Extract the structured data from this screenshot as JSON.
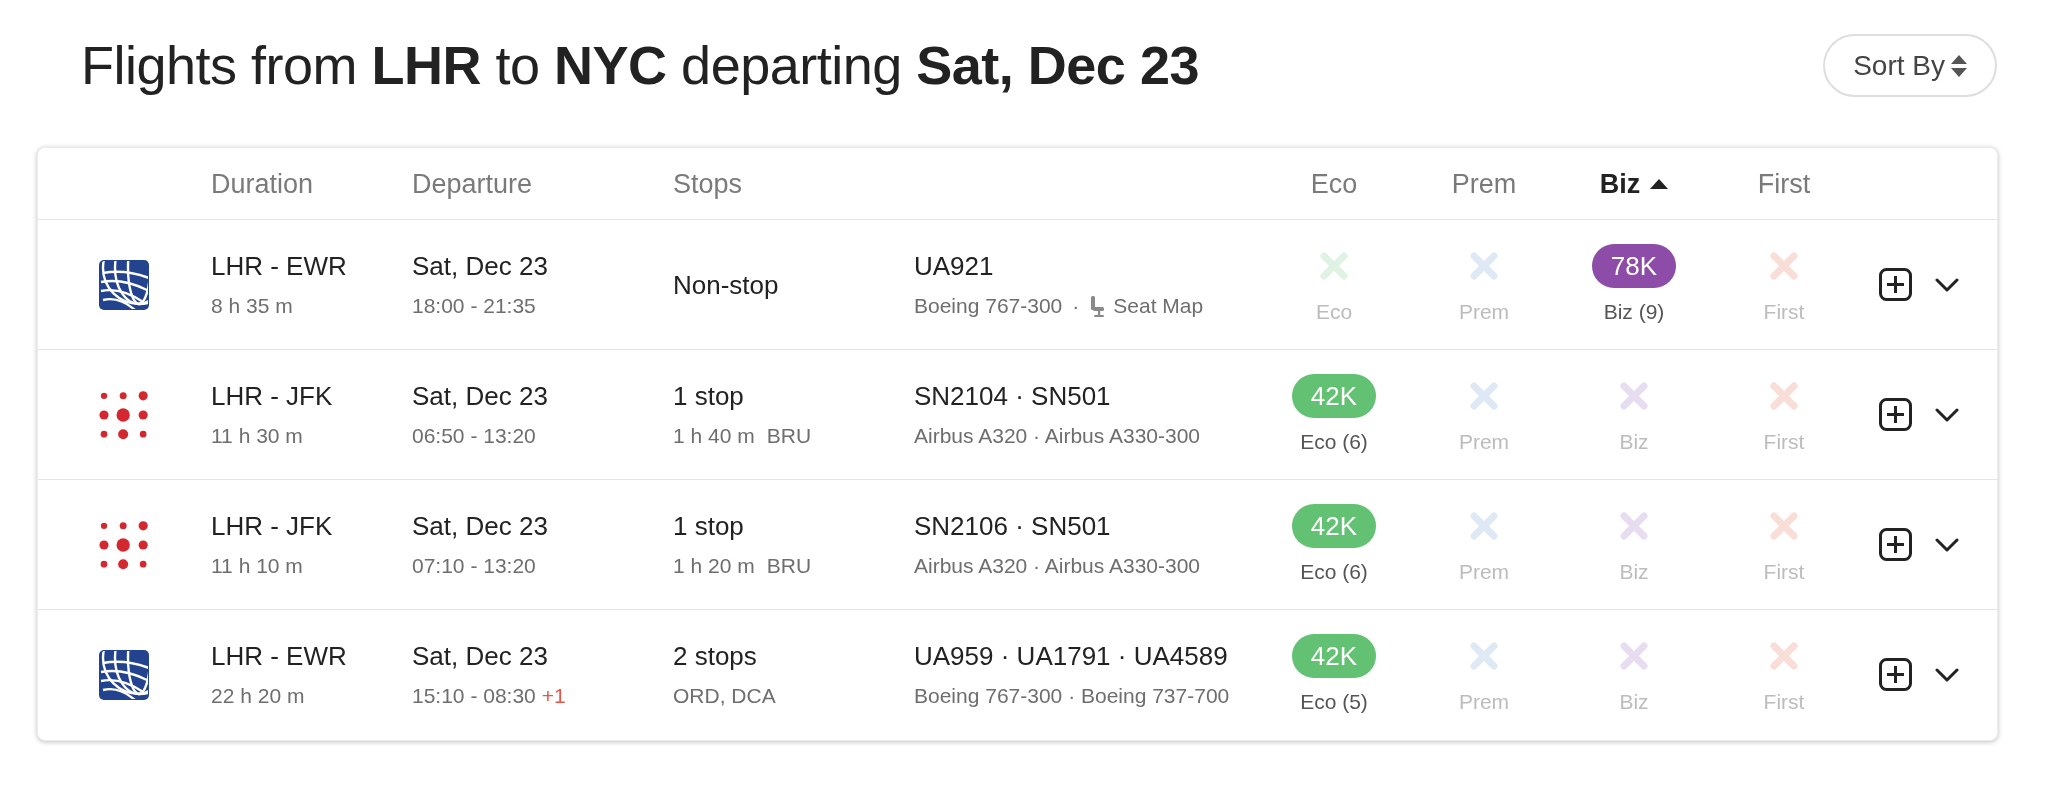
{
  "title": "Flights from **LHR** to **NYC** departing **Sat, Dec 23**",
  "sort_button": {
    "label": "Sort By"
  },
  "table": {
    "columns": [
      {
        "label": "Duration",
        "sorted": false
      },
      {
        "label": "Departure",
        "sorted": false
      },
      {
        "label": "Stops",
        "sorted": false
      }
    ],
    "cabins": [
      {
        "label": "Eco",
        "sorted": false,
        "color": "#dff2e3"
      },
      {
        "label": "Prem",
        "sorted": false,
        "color": "#dfe9f5"
      },
      {
        "label": "Biz",
        "sorted": true,
        "color": "#e8ddf0"
      },
      {
        "label": "First",
        "sorted": false,
        "color": "#f9ddd7"
      }
    ],
    "rows": [
      {
        "logo": {
          "kind": "globe"
        },
        "route": "LHR - EWR",
        "duration": "8 h 35 m",
        "date": "Sat, Dec 23",
        "times": "18:00 - 21:35",
        "stops": "Non-stop",
        "flights": "UA921",
        "aircraft": "Boeing 767-300",
        "seat_map": {
          "separator": "·",
          "label": "Seat Map"
        },
        "fares": [
          {
            "available": false,
            "label": "Eco"
          },
          {
            "available": false,
            "label": "Prem"
          },
          {
            "available": true,
            "price": "78K",
            "label": "Biz (9)",
            "color": "#8c4ca8"
          },
          {
            "available": false,
            "label": "First"
          }
        ],
        "expanded": false
      },
      {
        "logo": {
          "kind": "dots"
        },
        "route": "LHR - JFK",
        "duration": "11 h 30 m",
        "date": "Sat, Dec 23",
        "times": "06:50 - 13:20",
        "stops": "1 stop",
        "layover": {
          "duration": "1 h 40 m",
          "airports": "BRU"
        },
        "flights": "SN2104 · SN501",
        "aircraft": "Airbus A320 · Airbus A330-300",
        "fares": [
          {
            "available": true,
            "price": "42K",
            "label": "Eco (6)",
            "color": "#62c172"
          },
          {
            "available": false,
            "label": "Prem"
          },
          {
            "available": false,
            "label": "Biz"
          },
          {
            "available": false,
            "label": "First"
          }
        ],
        "expanded": false
      },
      {
        "logo": {
          "kind": "dots"
        },
        "route": "LHR - JFK",
        "duration": "11 h 10 m",
        "date": "Sat, Dec 23",
        "times": "07:10 - 13:20",
        "stops": "1 stop",
        "layover": {
          "duration": "1 h 20 m",
          "airports": "BRU"
        },
        "flights": "SN2106 · SN501",
        "aircraft": "Airbus A320 · Airbus A330-300",
        "fares": [
          {
            "available": true,
            "price": "42K",
            "label": "Eco (6)",
            "color": "#62c172"
          },
          {
            "available": false,
            "label": "Prem"
          },
          {
            "available": false,
            "label": "Biz"
          },
          {
            "available": false,
            "label": "First"
          }
        ],
        "expanded": false
      },
      {
        "logo": {
          "kind": "globe"
        },
        "route": "LHR - EWR",
        "duration": "22 h 20 m",
        "date": "Sat, Dec 23",
        "times": "15:10 - 08:30",
        "day_offset": "+1",
        "stops": "2 stops",
        "layover": {
          "airports": "ORD, DCA"
        },
        "flights": "UA959 · UA1791 · UA4589",
        "aircraft": "Boeing 767-300 · Boeing 737-700",
        "fares": [
          {
            "available": true,
            "price": "42K",
            "label": "Eco (5)",
            "color": "#62c172"
          },
          {
            "available": false,
            "label": "Prem"
          },
          {
            "available": false,
            "label": "Biz"
          },
          {
            "available": false,
            "label": "First"
          }
        ],
        "expanded": false
      }
    ]
  }
}
